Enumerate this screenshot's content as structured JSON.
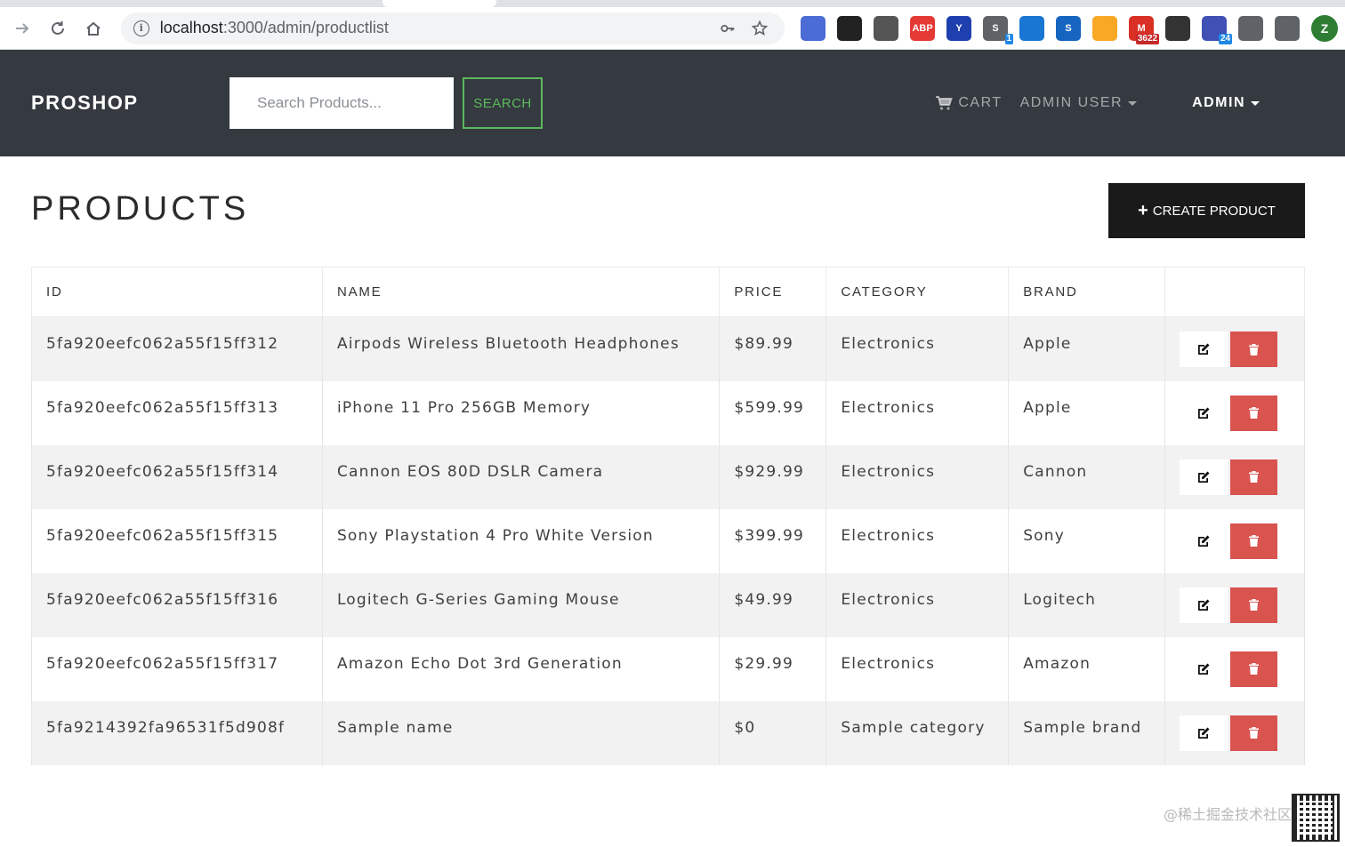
{
  "browser": {
    "url_host": "localhost",
    "url_rest": ":3000/admin/productlist",
    "extensions": [
      {
        "icon": "ext-mirror-icon",
        "color": "#4a6cd4",
        "label": "",
        "badge": ""
      },
      {
        "icon": "ext-glasses-icon",
        "color": "#222222",
        "label": "",
        "badge": ""
      },
      {
        "icon": "ext-recycle-icon",
        "color": "#555555",
        "label": "",
        "badge": ""
      },
      {
        "icon": "ext-abp-icon",
        "color": "#e53935",
        "label": "ABP",
        "badge": ""
      },
      {
        "icon": "ext-y-icon",
        "color": "#1e40af",
        "label": "Y",
        "badge": ""
      },
      {
        "icon": "ext-s-icon",
        "color": "#5f6368",
        "label": "S",
        "badge": "1"
      },
      {
        "icon": "ext-download-icon",
        "color": "#1976d2",
        "label": "",
        "badge": ""
      },
      {
        "icon": "ext-s-blue-icon",
        "color": "#1565c0",
        "label": "S",
        "badge": ""
      },
      {
        "icon": "ext-cat-icon",
        "color": "#f9a825",
        "label": "",
        "badge": ""
      },
      {
        "icon": "ext-gmail-icon",
        "color": "#d93025",
        "label": "M",
        "badge": "3622"
      },
      {
        "icon": "ext-qr-icon",
        "color": "#333333",
        "label": "",
        "badge": ""
      },
      {
        "icon": "ext-grad-icon",
        "color": "#3f51b5",
        "label": "",
        "badge": "24"
      },
      {
        "icon": "ext-puzzle-icon",
        "color": "#5f6368",
        "label": "",
        "badge": ""
      },
      {
        "icon": "ext-playlist-icon",
        "color": "#5f6368",
        "label": "",
        "badge": ""
      }
    ],
    "avatar_label": "Z"
  },
  "navbar": {
    "brand": "PROSHOP",
    "search_placeholder": "Search Products...",
    "search_button": "SEARCH",
    "cart": "CART",
    "user_menu": "ADMIN USER",
    "admin_menu": "ADMIN"
  },
  "page": {
    "title": "PRODUCTS",
    "create_button": "CREATE PRODUCT"
  },
  "table": {
    "headers": [
      "ID",
      "NAME",
      "PRICE",
      "CATEGORY",
      "BRAND"
    ],
    "rows": [
      {
        "id": "5fa920eefc062a55f15ff312",
        "name": "Airpods Wireless Bluetooth Headphones",
        "price": "$89.99",
        "category": "Electronics",
        "brand": "Apple"
      },
      {
        "id": "5fa920eefc062a55f15ff313",
        "name": "iPhone 11 Pro 256GB Memory",
        "price": "$599.99",
        "category": "Electronics",
        "brand": "Apple"
      },
      {
        "id": "5fa920eefc062a55f15ff314",
        "name": "Cannon EOS 80D DSLR Camera",
        "price": "$929.99",
        "category": "Electronics",
        "brand": "Cannon"
      },
      {
        "id": "5fa920eefc062a55f15ff315",
        "name": "Sony Playstation 4 Pro White Version",
        "price": "$399.99",
        "category": "Electronics",
        "brand": "Sony"
      },
      {
        "id": "5fa920eefc062a55f15ff316",
        "name": "Logitech G-Series Gaming Mouse",
        "price": "$49.99",
        "category": "Electronics",
        "brand": "Logitech"
      },
      {
        "id": "5fa920eefc062a55f15ff317",
        "name": "Amazon Echo Dot 3rd Generation",
        "price": "$29.99",
        "category": "Electronics",
        "brand": "Amazon"
      },
      {
        "id": "5fa9214392fa96531f5d908f",
        "name": "Sample name",
        "price": "$0",
        "category": "Sample category",
        "brand": "Sample brand"
      }
    ]
  },
  "watermark": "@稀土掘金技术社区",
  "colors": {
    "navbar_bg": "#343a40",
    "search_accent": "#5cb85c",
    "delete_red": "#d9534f",
    "create_btn_bg": "#1a1a1a"
  }
}
